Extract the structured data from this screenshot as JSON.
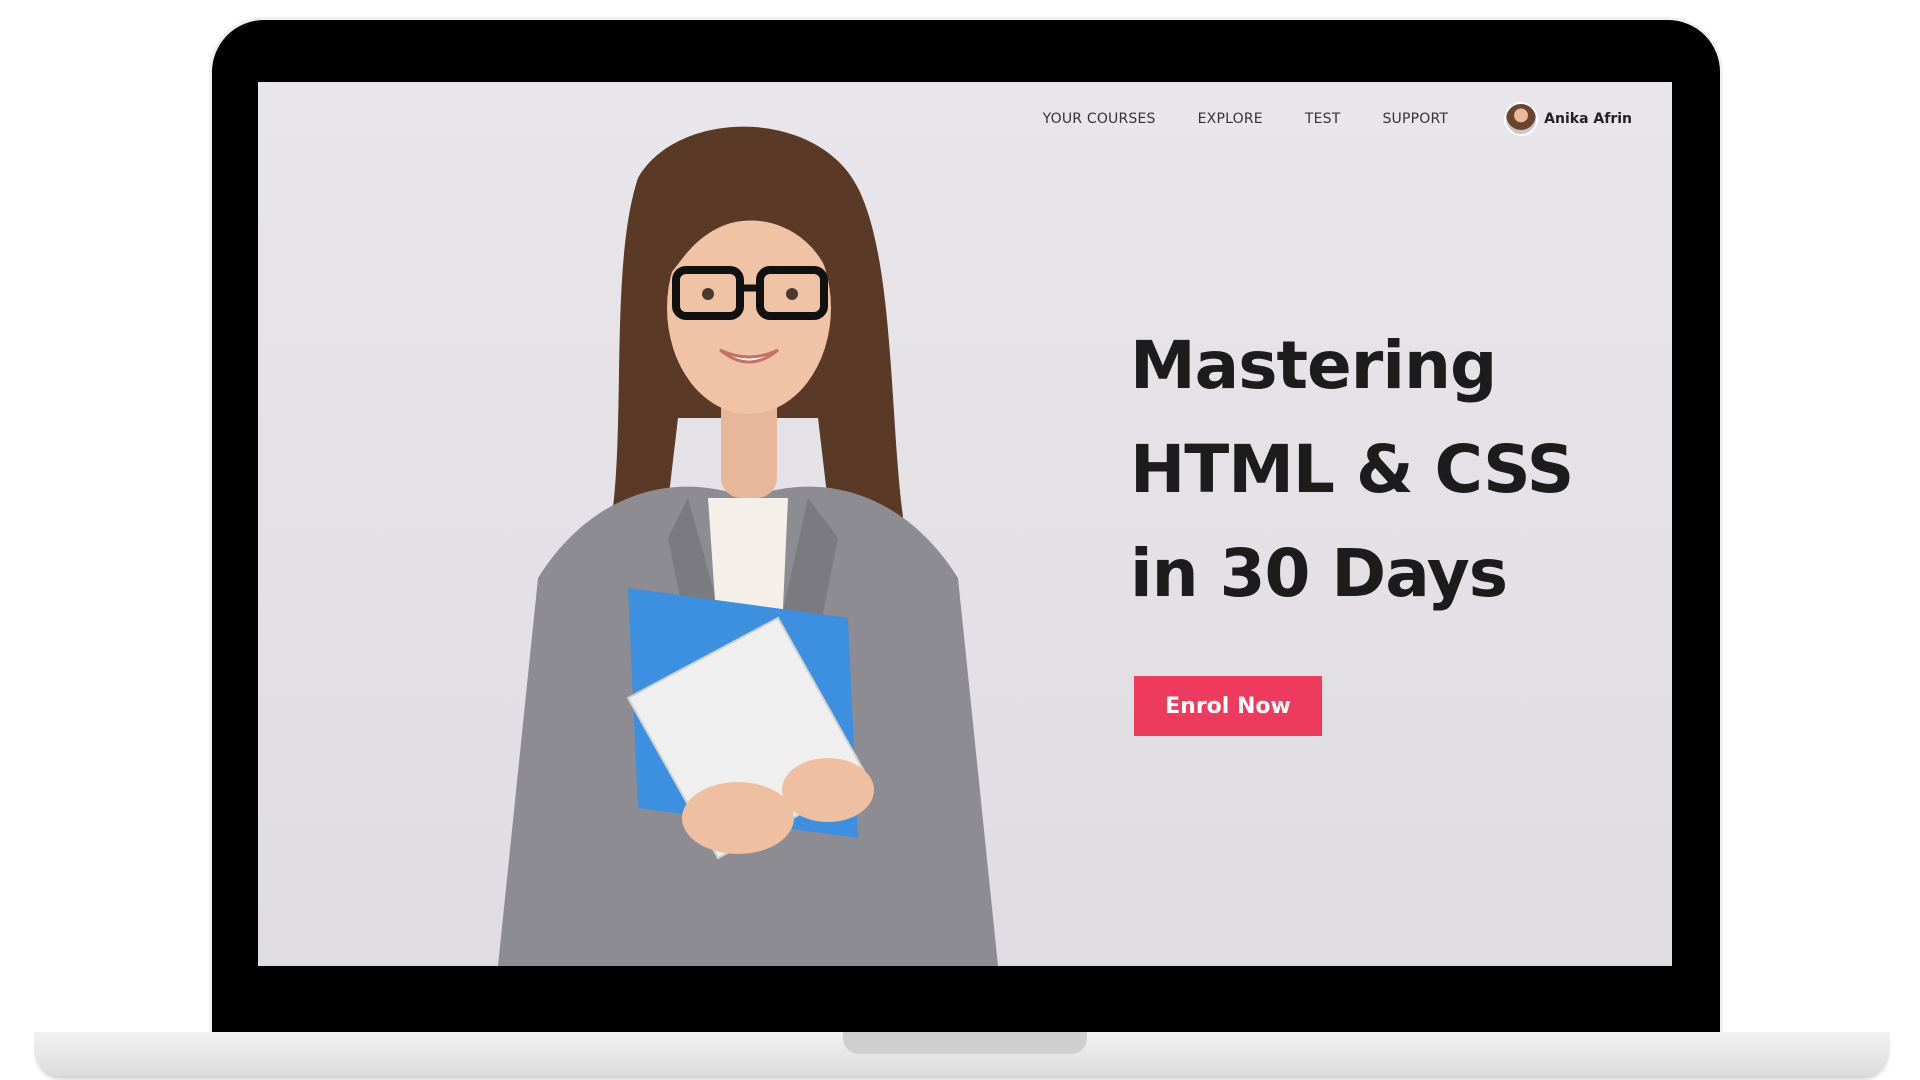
{
  "nav": {
    "links": [
      {
        "label": "YOUR COURSES"
      },
      {
        "label": "EXPLORE"
      },
      {
        "label": "TEST"
      },
      {
        "label": "SUPPORT"
      }
    ],
    "user": {
      "name": "Anika Afrin"
    }
  },
  "hero": {
    "title_lines": [
      "Mastering",
      "HTML & CSS",
      "in 30 Days"
    ],
    "cta_label": "Enrol Now"
  },
  "colors": {
    "accent": "#ee3a5d",
    "screen_background": "#e6e3e8",
    "laptop_frame": "#000000",
    "title_text": "#1c1c1c"
  },
  "icons": {
    "avatar": "user-avatar-icon"
  }
}
